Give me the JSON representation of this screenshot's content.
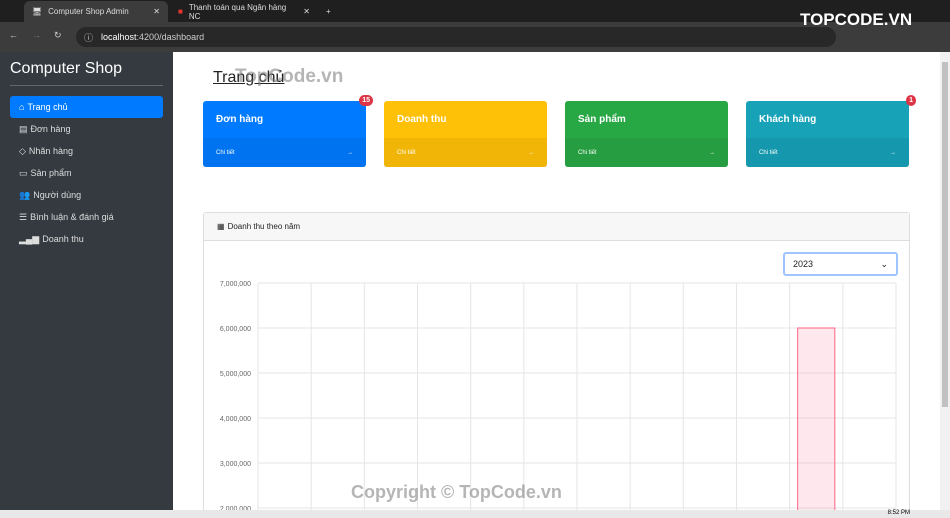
{
  "browser": {
    "tabs": [
      {
        "label": "Computer Shop Admin"
      },
      {
        "label": "Thanh toán qua Ngân hàng NC"
      }
    ],
    "url_host": "localhost",
    "url_path": ":4200/dashboard"
  },
  "sidebar": {
    "brand": "Computer Shop",
    "items": [
      {
        "label": "Trang chủ",
        "icon": "home-icon"
      },
      {
        "label": "Đơn hàng",
        "icon": "receipt-icon"
      },
      {
        "label": "Nhãn hàng",
        "icon": "tag-icon"
      },
      {
        "label": "Sản phẩm",
        "icon": "monitor-icon"
      },
      {
        "label": "Người dùng",
        "icon": "users-icon"
      },
      {
        "label": "Bình luận & đánh giá",
        "icon": "list-icon"
      },
      {
        "label": "Doanh thu",
        "icon": "bar-chart-icon"
      }
    ]
  },
  "main": {
    "title": "Trang chủ",
    "cards": [
      {
        "title": "Đơn hàng",
        "link": "Chi tiết",
        "badge": "15",
        "color": "#007bff"
      },
      {
        "title": "Doanh thu",
        "link": "Chi tiết",
        "badge": "",
        "color": "#ffc107"
      },
      {
        "title": "Sản phẩm",
        "link": "Chi tiết",
        "badge": "",
        "color": "#28a745"
      },
      {
        "title": "Khách hàng",
        "link": "Chi tiết",
        "badge": "1",
        "color": "#17a2b8"
      }
    ],
    "panel_title": "Doanh thu theo năm",
    "year_select": "2023"
  },
  "watermarks": {
    "top": "TopCode.vn",
    "bottom": "Copyright © TopCode.vn",
    "logo": "TOPCODE.VN"
  },
  "taskbar": {
    "time": "8:52 PM"
  },
  "chart_data": {
    "type": "bar",
    "values": [
      0,
      0,
      0,
      0,
      0,
      0,
      0,
      0,
      0,
      0,
      6000000,
      0
    ],
    "ylim": [
      2000000,
      7000000
    ],
    "yticks": [
      "7,000,000",
      "6,000,000",
      "5,000,000",
      "4,000,000",
      "3,000,000",
      "2,000,000"
    ],
    "grid": true,
    "bar_color": "#ff6384"
  }
}
